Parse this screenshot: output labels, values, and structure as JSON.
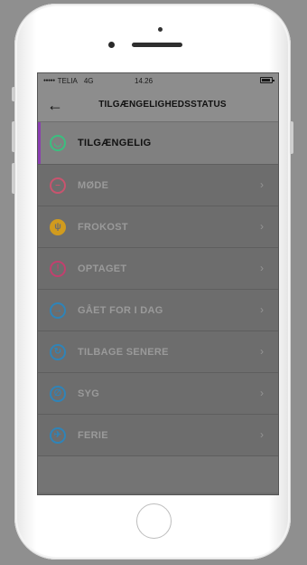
{
  "statusbar": {
    "signal": "●●●●●",
    "carrier": "TELIA",
    "network": "4G",
    "time": "14.26"
  },
  "navbar": {
    "back_icon": "←",
    "title": "TILGÆNGELIGHEDSSTATUS"
  },
  "statuses": [
    {
      "label": "TILGÆNGELIG",
      "icon": "smile-icon",
      "color": "#3bbf7f",
      "selected": true
    },
    {
      "label": "MØDE",
      "icon": "minus-icon",
      "color": "#c8546e"
    },
    {
      "label": "FROKOST",
      "icon": "cutlery-icon",
      "color": "#d19b1e"
    },
    {
      "label": "OPTAGET",
      "icon": "exclamation-icon",
      "color": "#c2406e"
    },
    {
      "label": "GÅET FOR I DAG",
      "icon": "arrow-right-icon",
      "color": "#2f84b8"
    },
    {
      "label": "TILBAGE SENERE",
      "icon": "refresh-icon",
      "color": "#2f84b8"
    },
    {
      "label": "SYG",
      "icon": "bandage-icon",
      "color": "#2f84b8"
    },
    {
      "label": "FERIE",
      "icon": "plane-icon",
      "color": "#2f84b8"
    }
  ],
  "chevron": "›"
}
